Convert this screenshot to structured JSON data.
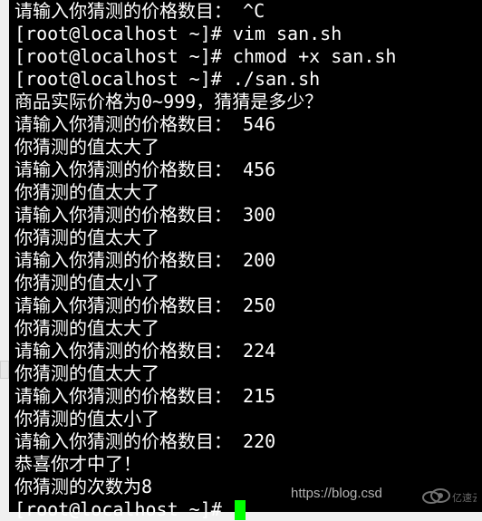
{
  "terminal": {
    "lines": [
      {
        "type": "plain",
        "text": "请输入你猜测的价格数目： ^C"
      },
      {
        "type": "prompt",
        "prompt": "[root@localhost ~]# ",
        "cmd": "vim san.sh"
      },
      {
        "type": "prompt",
        "prompt": "[root@localhost ~]# ",
        "cmd": "chmod +x san.sh"
      },
      {
        "type": "prompt",
        "prompt": "[root@localhost ~]# ",
        "cmd": "./san.sh"
      },
      {
        "type": "plain",
        "text": "商品实际价格为0~999，猜猜是多少？"
      },
      {
        "type": "plain",
        "text": "请输入你猜测的价格数目： 546"
      },
      {
        "type": "plain",
        "text": "你猜测的值太大了"
      },
      {
        "type": "plain",
        "text": "请输入你猜测的价格数目： 456"
      },
      {
        "type": "plain",
        "text": "你猜测的值太大了"
      },
      {
        "type": "plain",
        "text": "请输入你猜测的价格数目： 300"
      },
      {
        "type": "plain",
        "text": "你猜测的值太大了"
      },
      {
        "type": "plain",
        "text": "请输入你猜测的价格数目： 200"
      },
      {
        "type": "plain",
        "text": "你猜测的值太小了"
      },
      {
        "type": "plain",
        "text": "请输入你猜测的价格数目： 250"
      },
      {
        "type": "plain",
        "text": "你猜测的值太大了"
      },
      {
        "type": "plain",
        "text": "请输入你猜测的价格数目： 224"
      },
      {
        "type": "plain",
        "text": "你猜测的值太大了"
      },
      {
        "type": "plain",
        "text": "请输入你猜测的价格数目： 215"
      },
      {
        "type": "plain",
        "text": "你猜测的值太小了"
      },
      {
        "type": "plain",
        "text": "请输入你猜测的价格数目： 220"
      },
      {
        "type": "plain",
        "text": "恭喜你才中了！"
      },
      {
        "type": "plain",
        "text": "你猜测的次数为8"
      },
      {
        "type": "prompt",
        "prompt": "[root@localhost ~]# ",
        "cmd": "",
        "cursor": true
      }
    ]
  },
  "watermark": {
    "url_fragment": "https://blog.csd",
    "brand": "亿速云"
  }
}
